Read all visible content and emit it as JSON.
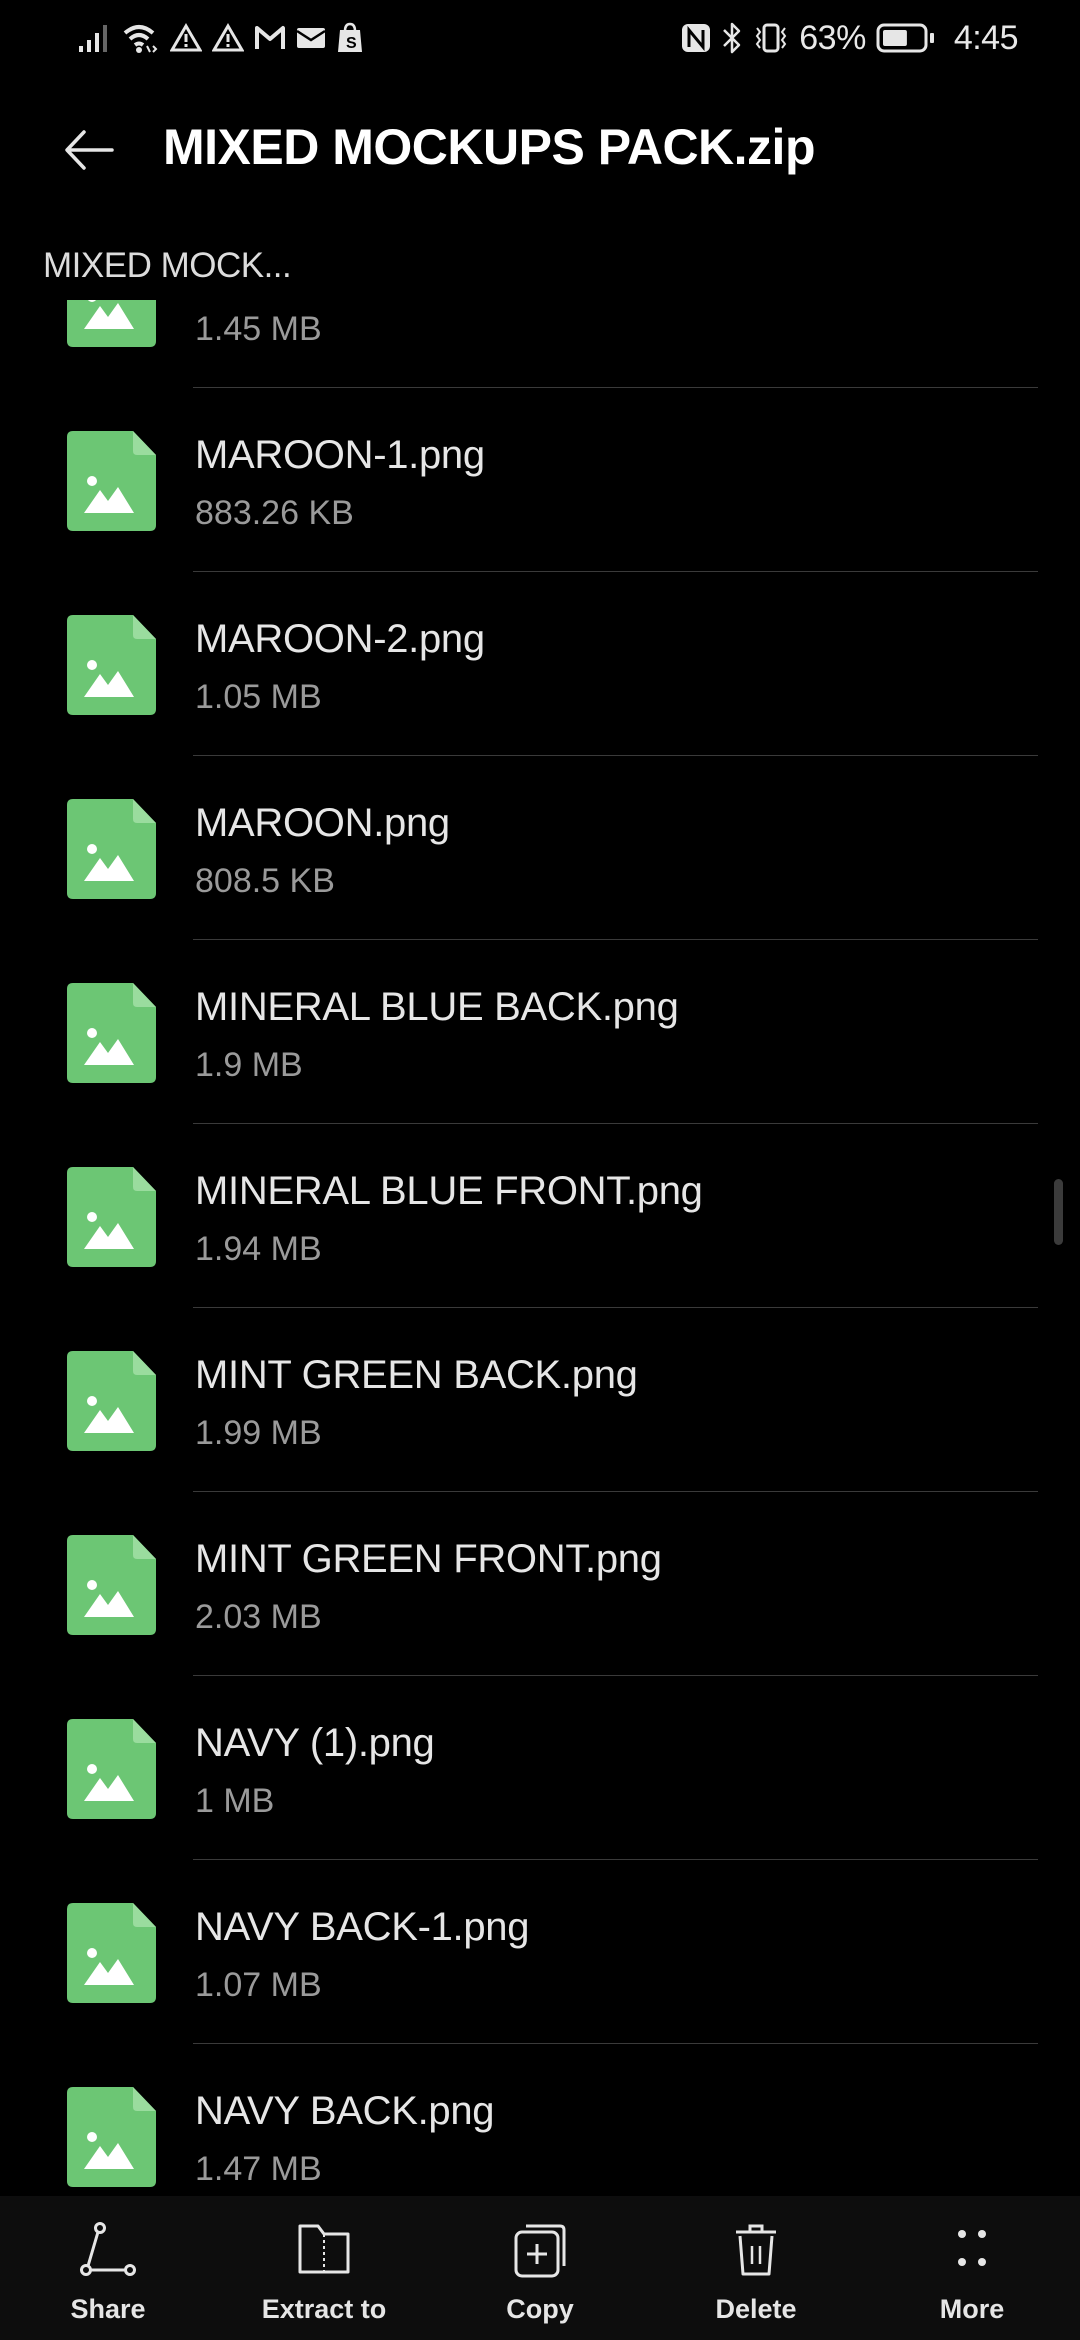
{
  "status_bar": {
    "left_icons": [
      "signal-icon",
      "wifi-icon",
      "warning-icon",
      "warning-icon",
      "gmail-icon",
      "mail-icon",
      "shopify-icon"
    ],
    "right_icons": [
      "nfc-icon",
      "bluetooth-icon",
      "vibrate-icon"
    ],
    "battery_percent": "63%",
    "battery_level": 0.63,
    "time": "4:45"
  },
  "header": {
    "back_icon": "back-arrow-icon",
    "title": "MIXED MOCKUPS PACK.zip"
  },
  "breadcrumb": "MIXED MOCK...",
  "colors": {
    "background": "#000000",
    "file_icon_green": "#6cc674",
    "file_icon_fold": "#9adc9e",
    "bottom_bar": "#0d0d0d",
    "secondary_text": "#9a9a9a"
  },
  "files": [
    {
      "name": "",
      "size": "1.45 MB"
    },
    {
      "name": "MAROON-1.png",
      "size": "883.26 KB"
    },
    {
      "name": "MAROON-2.png",
      "size": "1.05 MB"
    },
    {
      "name": "MAROON.png",
      "size": "808.5 KB"
    },
    {
      "name": "MINERAL BLUE BACK.png",
      "size": "1.9 MB"
    },
    {
      "name": "MINERAL BLUE FRONT.png",
      "size": "1.94 MB"
    },
    {
      "name": "MINT GREEN BACK.png",
      "size": "1.99 MB"
    },
    {
      "name": "MINT GREEN FRONT.png",
      "size": "2.03 MB"
    },
    {
      "name": "NAVY (1).png",
      "size": "1 MB"
    },
    {
      "name": "NAVY BACK-1.png",
      "size": "1.07 MB"
    },
    {
      "name": "NAVY BACK.png",
      "size": "1.47 MB"
    }
  ],
  "bottom_bar": {
    "items": [
      {
        "label": "Share",
        "icon": "share-icon"
      },
      {
        "label": "Extract to",
        "icon": "extract-folder-icon"
      },
      {
        "label": "Copy",
        "icon": "copy-icon"
      },
      {
        "label": "Delete",
        "icon": "trash-icon"
      },
      {
        "label": "More",
        "icon": "more-dots-icon"
      }
    ]
  }
}
